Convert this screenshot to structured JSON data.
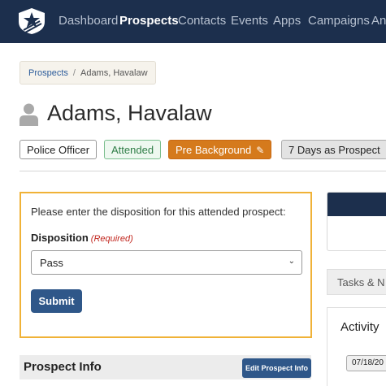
{
  "nav": {
    "items": [
      {
        "label": "Dashboard",
        "active": false
      },
      {
        "label": "Prospects",
        "active": true
      },
      {
        "label": "Contacts",
        "active": false
      },
      {
        "label": "Events",
        "active": false
      },
      {
        "label": "Apps",
        "active": false
      },
      {
        "label": "Campaigns",
        "active": false
      },
      {
        "label": "Ana",
        "active": false
      }
    ],
    "logo_icon": "star-shield-logo"
  },
  "breadcrumb": {
    "parent": "Prospects",
    "separator": "/",
    "current": "Adams, Havalaw"
  },
  "prospect": {
    "avatar_icon": "user-icon",
    "name": "Adams, Havalaw",
    "badges": {
      "role": "Police Officer",
      "status": "Attended",
      "stage": "Pre Background",
      "stage_icon": "pencil-icon",
      "days": "7 Days as Prospect"
    }
  },
  "disposition": {
    "prompt": "Please enter the disposition for this attended prospect:",
    "label": "Disposition",
    "required_text": "(Required)",
    "selected": "Pass",
    "submit_label": "Submit"
  },
  "prospect_info": {
    "title": "Prospect Info",
    "edit_label": "Edit Prospect Info"
  },
  "side": {
    "tasks_tab": "Tasks & N",
    "activity_title": "Activity",
    "activity_date": "07/18/20"
  },
  "colors": {
    "nav_bg": "#1c2f4d",
    "primary_button": "#2f5789",
    "stage_badge": "#d57a1c",
    "highlight_border": "#f0b237",
    "required": "#c2271f",
    "attended_green": "#2e7d46"
  }
}
